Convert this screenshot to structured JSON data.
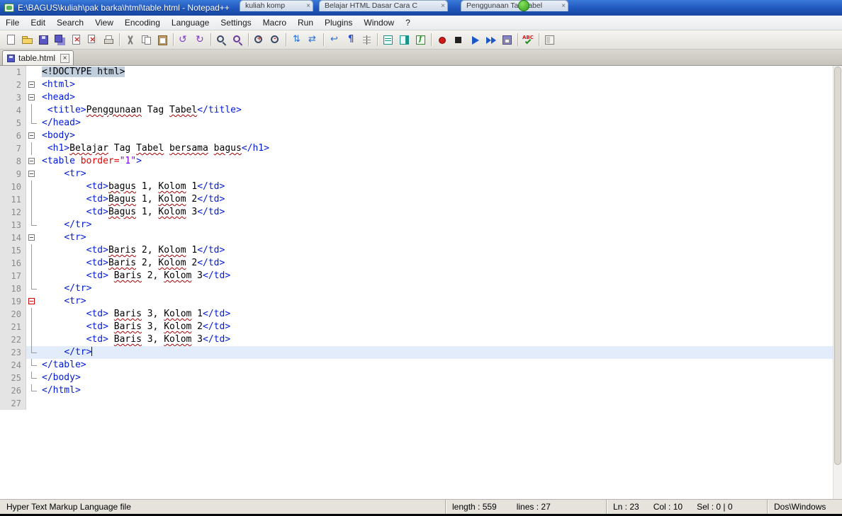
{
  "titlebar": {
    "title": "E:\\BAGUS\\kuliah\\pak barka\\html\\table.html - Notepad++"
  },
  "browser": {
    "close_glyph": "×",
    "tabs": [
      {
        "label": "kuliah komp"
      },
      {
        "label": "Belajar HTML Dasar Cara C"
      },
      {
        "label": "Penggunaan Tag Tabel"
      }
    ]
  },
  "menubar": {
    "items": [
      "File",
      "Edit",
      "Search",
      "View",
      "Encoding",
      "Language",
      "Settings",
      "Macro",
      "Run",
      "Plugins",
      "Window",
      "?"
    ]
  },
  "toolbar": {
    "groups": [
      [
        "new-file",
        "open",
        "save",
        "save-all",
        "close",
        "close-all",
        "print"
      ],
      [
        "cut",
        "copy",
        "paste"
      ],
      [
        "undo",
        "redo"
      ],
      [
        "find",
        "replace"
      ],
      [
        "zoom-in",
        "zoom-out"
      ],
      [
        "sync-scroll-vertical",
        "sync-scroll-horizontal"
      ],
      [
        "word-wrap",
        "show-all-characters",
        "indent-guide"
      ],
      [
        "user-define-dialog",
        "doc-map",
        "function-list"
      ],
      [
        "macro-record",
        "macro-stop",
        "macro-play",
        "macro-run-multiple",
        "macro-save"
      ],
      [
        "spell-check"
      ],
      [
        "panels"
      ]
    ]
  },
  "doctabs": {
    "close_glyph": "×",
    "tabs": [
      {
        "label": "table.html"
      }
    ]
  },
  "editor": {
    "lines": [
      {
        "no": 1,
        "fold": "none",
        "segs": [
          [
            "dochl",
            "<!DOCTYPE html>"
          ]
        ]
      },
      {
        "no": 2,
        "fold": "box",
        "segs": [
          [
            "tag",
            "<html>"
          ]
        ]
      },
      {
        "no": 3,
        "fold": "box",
        "segs": [
          [
            "tag",
            "<head>"
          ]
        ]
      },
      {
        "no": 4,
        "fold": "line",
        "segs": [
          [
            "pl",
            " "
          ],
          [
            "tag",
            "<title>"
          ],
          [
            "mis",
            "Penggunaan"
          ],
          [
            "pl",
            " Tag "
          ],
          [
            "mis",
            "Tabel"
          ],
          [
            "tag",
            "</title>"
          ]
        ]
      },
      {
        "no": 5,
        "fold": "end",
        "segs": [
          [
            "tag",
            "</head>"
          ]
        ]
      },
      {
        "no": 6,
        "fold": "box",
        "segs": [
          [
            "tag",
            "<body>"
          ]
        ]
      },
      {
        "no": 7,
        "fold": "line",
        "segs": [
          [
            "pl",
            " "
          ],
          [
            "tag",
            "<h1>"
          ],
          [
            "mis",
            "Belajar"
          ],
          [
            "pl",
            " Tag "
          ],
          [
            "mis",
            "Tabel"
          ],
          [
            "pl",
            " "
          ],
          [
            "mis",
            "bersama"
          ],
          [
            "pl",
            " "
          ],
          [
            "mis",
            "bagus"
          ],
          [
            "tag",
            "</h1>"
          ]
        ]
      },
      {
        "no": 8,
        "fold": "box",
        "segs": [
          [
            "tag",
            "<table "
          ],
          [
            "attr",
            "border="
          ],
          [
            "val",
            "\"1\""
          ],
          [
            "tag",
            ">"
          ]
        ]
      },
      {
        "no": 9,
        "fold": "box",
        "segs": [
          [
            "pl",
            "    "
          ],
          [
            "tag",
            "<tr>"
          ]
        ]
      },
      {
        "no": 10,
        "fold": "line",
        "segs": [
          [
            "pl",
            "        "
          ],
          [
            "tag",
            "<td>"
          ],
          [
            "mis",
            "bagus"
          ],
          [
            "pl",
            " 1, "
          ],
          [
            "mis",
            "Kolom"
          ],
          [
            "pl",
            " 1"
          ],
          [
            "tag",
            "</td>"
          ]
        ]
      },
      {
        "no": 11,
        "fold": "line",
        "segs": [
          [
            "pl",
            "        "
          ],
          [
            "tag",
            "<td>"
          ],
          [
            "mis",
            "Bagus"
          ],
          [
            "pl",
            " 1, "
          ],
          [
            "mis",
            "Kolom"
          ],
          [
            "pl",
            " 2"
          ],
          [
            "tag",
            "</td>"
          ]
        ]
      },
      {
        "no": 12,
        "fold": "line",
        "segs": [
          [
            "pl",
            "        "
          ],
          [
            "tag",
            "<td>"
          ],
          [
            "mis",
            "Bagus"
          ],
          [
            "pl",
            " 1, "
          ],
          [
            "mis",
            "Kolom"
          ],
          [
            "pl",
            " 3"
          ],
          [
            "tag",
            "</td>"
          ]
        ]
      },
      {
        "no": 13,
        "fold": "end",
        "segs": [
          [
            "pl",
            "    "
          ],
          [
            "tag",
            "</tr>"
          ]
        ]
      },
      {
        "no": 14,
        "fold": "box",
        "segs": [
          [
            "pl",
            "    "
          ],
          [
            "tag",
            "<tr>"
          ]
        ]
      },
      {
        "no": 15,
        "fold": "line",
        "segs": [
          [
            "pl",
            "        "
          ],
          [
            "tag",
            "<td>"
          ],
          [
            "mis",
            "Baris"
          ],
          [
            "pl",
            " 2, "
          ],
          [
            "mis",
            "Kolom"
          ],
          [
            "pl",
            " 1"
          ],
          [
            "tag",
            "</td>"
          ]
        ]
      },
      {
        "no": 16,
        "fold": "line",
        "segs": [
          [
            "pl",
            "        "
          ],
          [
            "tag",
            "<td>"
          ],
          [
            "mis",
            "Baris"
          ],
          [
            "pl",
            " 2, "
          ],
          [
            "mis",
            "Kolom"
          ],
          [
            "pl",
            " 2"
          ],
          [
            "tag",
            "</td>"
          ]
        ]
      },
      {
        "no": 17,
        "fold": "line",
        "segs": [
          [
            "pl",
            "        "
          ],
          [
            "tag",
            "<td>"
          ],
          [
            "pl",
            " "
          ],
          [
            "mis",
            "Baris"
          ],
          [
            "pl",
            " 2, "
          ],
          [
            "mis",
            "Kolom"
          ],
          [
            "pl",
            " 3"
          ],
          [
            "tag",
            "</td>"
          ]
        ]
      },
      {
        "no": 18,
        "fold": "end",
        "segs": [
          [
            "pl",
            "    "
          ],
          [
            "tag",
            "</tr>"
          ]
        ]
      },
      {
        "no": 19,
        "fold": "box-active",
        "segs": [
          [
            "pl",
            "    "
          ],
          [
            "tag",
            "<tr>"
          ]
        ]
      },
      {
        "no": 20,
        "fold": "line",
        "segs": [
          [
            "pl",
            "        "
          ],
          [
            "tag",
            "<td>"
          ],
          [
            "pl",
            " "
          ],
          [
            "mis",
            "Baris"
          ],
          [
            "pl",
            " 3, "
          ],
          [
            "mis",
            "Kolom"
          ],
          [
            "pl",
            " 1"
          ],
          [
            "tag",
            "</td>"
          ]
        ]
      },
      {
        "no": 21,
        "fold": "line",
        "segs": [
          [
            "pl",
            "        "
          ],
          [
            "tag",
            "<td>"
          ],
          [
            "pl",
            " "
          ],
          [
            "mis",
            "Baris"
          ],
          [
            "pl",
            " 3, "
          ],
          [
            "mis",
            "Kolom"
          ],
          [
            "pl",
            " 2"
          ],
          [
            "tag",
            "</td>"
          ]
        ]
      },
      {
        "no": 22,
        "fold": "line",
        "segs": [
          [
            "pl",
            "        "
          ],
          [
            "tag",
            "<td>"
          ],
          [
            "pl",
            " "
          ],
          [
            "mis",
            "Baris"
          ],
          [
            "pl",
            " 3, "
          ],
          [
            "mis",
            "Kolom"
          ],
          [
            "pl",
            " 3"
          ],
          [
            "tag",
            "</td>"
          ]
        ]
      },
      {
        "no": 23,
        "fold": "end",
        "current": true,
        "caret": true,
        "segs": [
          [
            "pl",
            "    "
          ],
          [
            "tag",
            "</tr>"
          ]
        ]
      },
      {
        "no": 24,
        "fold": "end",
        "segs": [
          [
            "tag",
            "</table>"
          ]
        ]
      },
      {
        "no": 25,
        "fold": "end",
        "segs": [
          [
            "tag",
            "</body>"
          ]
        ]
      },
      {
        "no": 26,
        "fold": "end",
        "segs": [
          [
            "tag",
            "</html>"
          ]
        ]
      },
      {
        "no": 27,
        "fold": "none",
        "segs": []
      }
    ]
  },
  "statusbar": {
    "doc_type": "Hyper Text Markup Language file",
    "length": "length : 559",
    "lines": "lines : 27",
    "ln": "Ln : 23",
    "col": "Col : 10",
    "sel": "Sel : 0 | 0",
    "eol": "Dos\\Windows"
  }
}
